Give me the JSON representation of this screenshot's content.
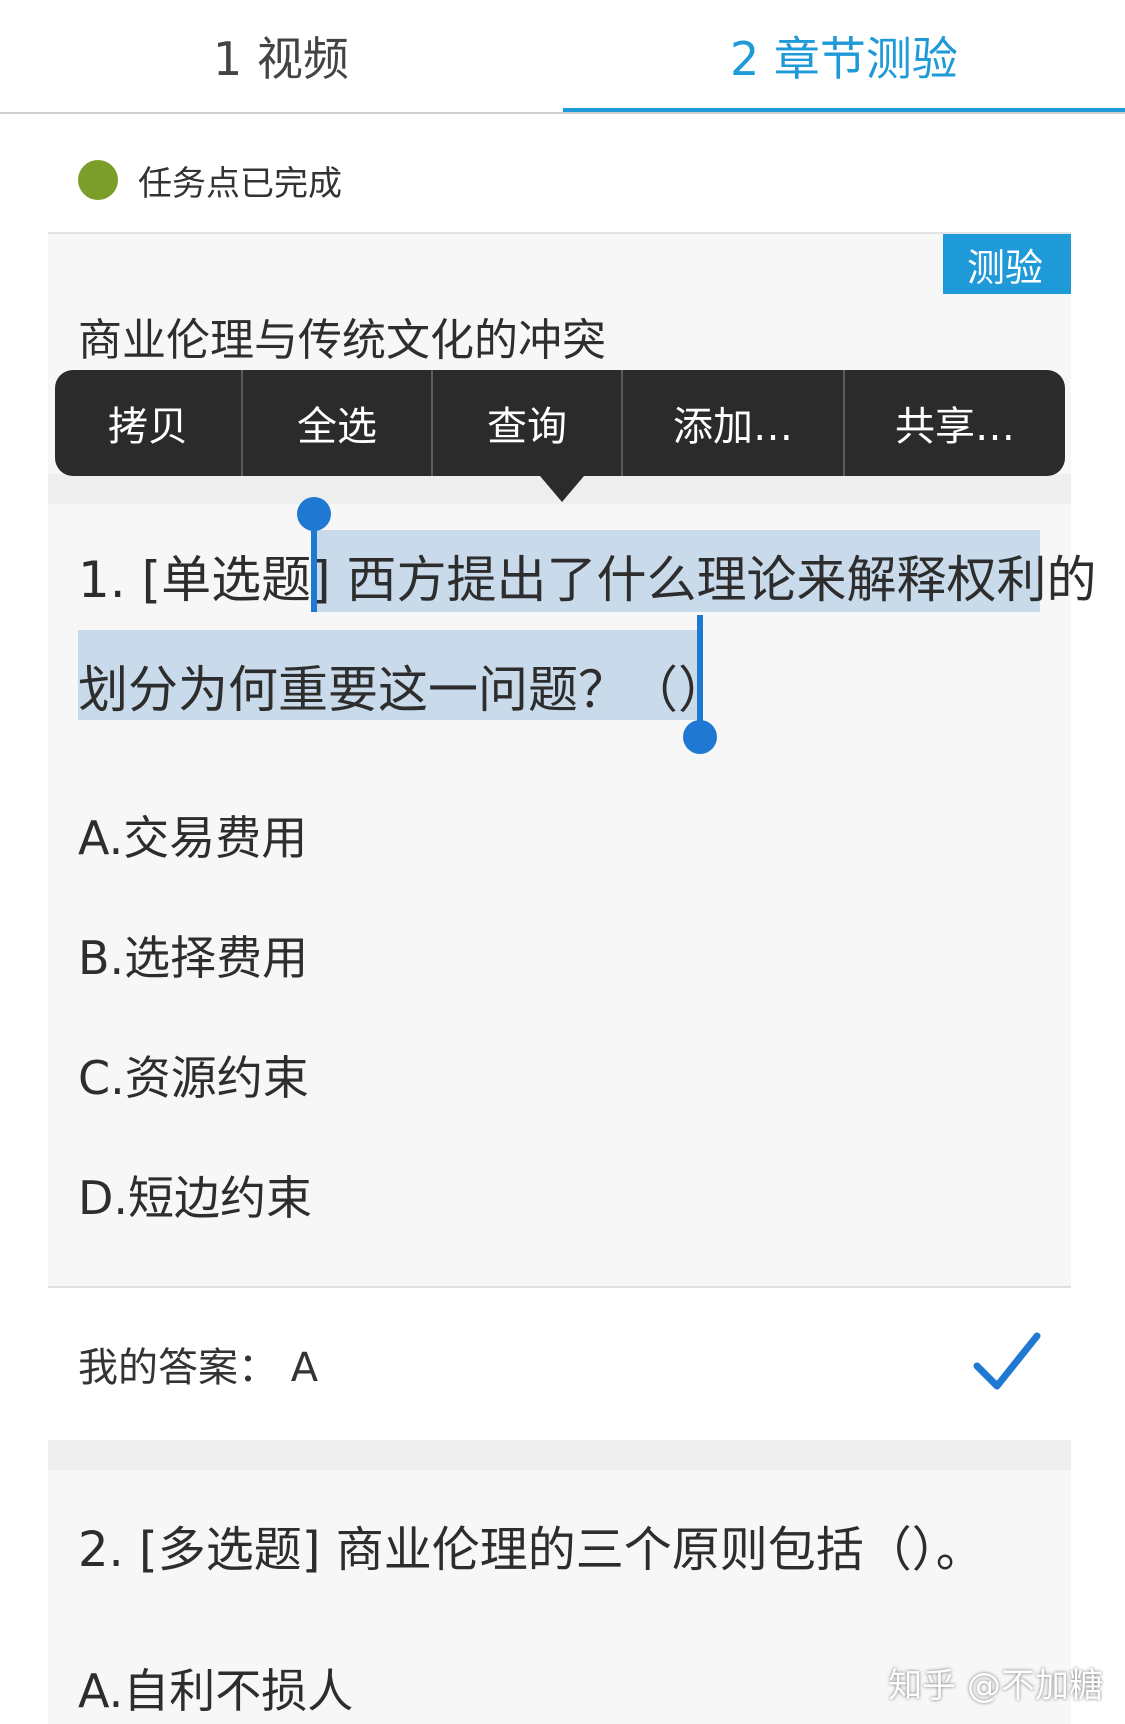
{
  "tabs": [
    {
      "label": "1 视频"
    },
    {
      "label": "2 章节测验"
    }
  ],
  "status": {
    "text": "任务点已完成"
  },
  "quiz": {
    "badge": "测验",
    "title": "商业伦理与传统文化的冲突"
  },
  "context_menu": {
    "items": [
      "拷贝",
      "全选",
      "查询",
      "添加…",
      "共享…"
    ]
  },
  "question1": {
    "prefix": "1. [单选题] ",
    "line1_selected": "西方提出了什么理论来解释权利的",
    "line2": "划分为何重要这一问题？（）",
    "options": [
      "A.交易费用",
      "B.选择费用",
      "C.资源约束",
      "D.短边约束"
    ]
  },
  "answer": {
    "text": "我的答案：  A",
    "correct": true
  },
  "question2": {
    "text": "2. [多选题] 商业伦理的三个原则包括（）。",
    "options": [
      "A.自利不损人"
    ]
  },
  "watermark": "知乎 @不加糖",
  "colors": {
    "accent": "#1f9ad8",
    "status": "#7b9e2b",
    "selection": "#c9dbea"
  }
}
